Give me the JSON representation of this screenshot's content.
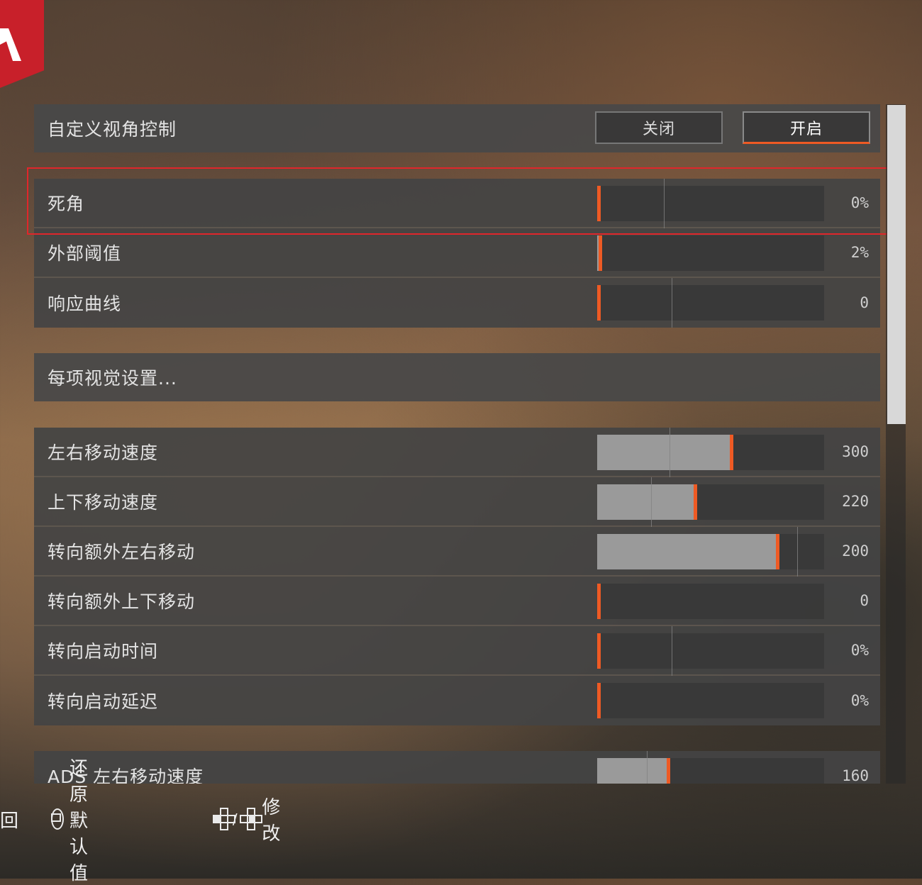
{
  "header": {
    "title": "自定义视角控制",
    "off_label": "关闭",
    "on_label": "开启",
    "selected": "开启"
  },
  "group1": [
    {
      "label": "死角",
      "value": "0%",
      "fill": 0.0
    },
    {
      "label": "外部阈值",
      "value": "2%",
      "fill": 0.02
    },
    {
      "label": "响应曲线",
      "value": "0",
      "fill": 0.0
    }
  ],
  "per_weapon": {
    "label": "每项视觉设置..."
  },
  "group2": [
    {
      "label": "左右移动速度",
      "value": "300",
      "fill": 0.59
    },
    {
      "label": "上下移动速度",
      "value": "220",
      "fill": 0.43
    },
    {
      "label": "转向额外左右移动",
      "value": "200",
      "fill": 0.79
    },
    {
      "label": "转向额外上下移动",
      "value": "0",
      "fill": 0.0
    },
    {
      "label": "转向启动时间",
      "value": "0%",
      "fill": 0.0
    },
    {
      "label": "转向启动延迟",
      "value": "0%",
      "fill": 0.0
    }
  ],
  "group3": [
    {
      "label": "ADS 左右移动速度",
      "value": "160",
      "fill": 0.31
    }
  ],
  "footer": {
    "back": "回",
    "reset": "还原默认值",
    "modify_sep": "/",
    "modify": "修改"
  },
  "colors": {
    "accent": "#ee5a24",
    "highlight": "#e0262b",
    "logo": "#c8202a"
  }
}
